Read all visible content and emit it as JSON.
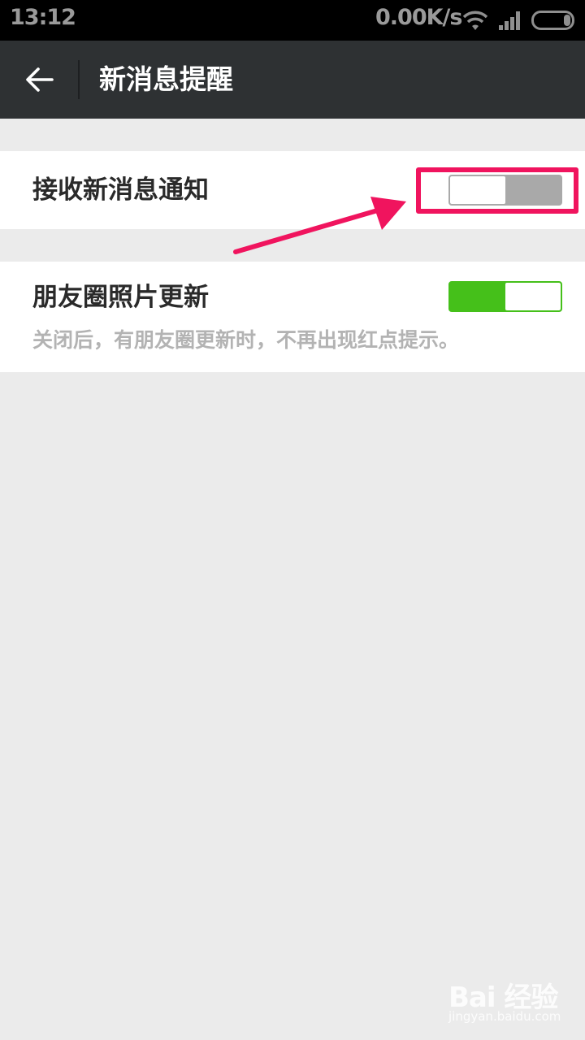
{
  "status_bar": {
    "time": "13:12",
    "net_speed": "0.00K/s",
    "icons": [
      "wifi-icon",
      "signal-icon",
      "battery-icon"
    ]
  },
  "title_bar": {
    "back_icon": "arrow-left-icon",
    "title": "新消息提醒"
  },
  "settings": [
    {
      "label": "接收新消息通知",
      "toggle_state": "off",
      "highlighted": true
    },
    {
      "label": "朋友圈照片更新",
      "description": "关闭后，有朋友圈更新时，不再出现红点提示。",
      "toggle_state": "on"
    }
  ],
  "annotation": {
    "color": "#f0145e",
    "type": "arrow-and-box"
  },
  "watermark": {
    "brand": "Bai 经验",
    "sub": "jingyan.baidu.com"
  },
  "colors": {
    "status_bar_bg": "#000000",
    "title_bar_bg": "#2e3133",
    "page_bg": "#ebebeb",
    "toggle_on": "#45c01a",
    "toggle_off": "#a9a9a9"
  }
}
